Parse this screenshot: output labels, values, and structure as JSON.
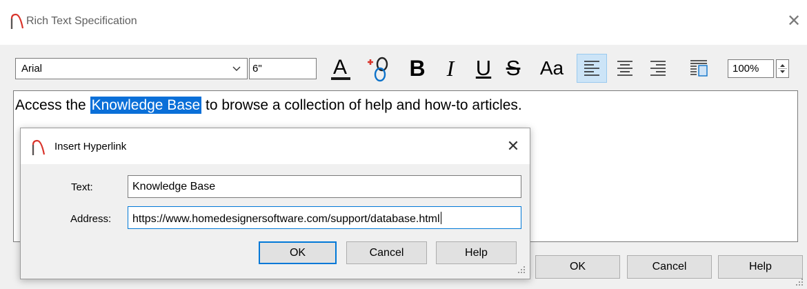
{
  "main_window": {
    "title": "Rich Text Specification",
    "toolbar": {
      "font": "Arial",
      "size": "6\"",
      "zoom": "100%",
      "case_label": "Aa"
    },
    "editor": {
      "text_before": "Access the ",
      "link_text": "Knowledge Base",
      "text_after": " to browse a collection of help and how-to articles."
    },
    "buttons": {
      "ok": "OK",
      "cancel": "Cancel",
      "help": "Help"
    }
  },
  "dialog": {
    "title": "Insert Hyperlink",
    "text_label": "Text:",
    "text_value": "Knowledge Base",
    "address_label": "Address:",
    "address_value": "https://www.homedesignersoftware.com/support/database.html",
    "buttons": {
      "ok": "OK",
      "cancel": "Cancel",
      "help": "Help"
    }
  },
  "colors": {
    "selection": "#0a6fd8",
    "accent": "#0078d7",
    "app_icon": "#d9342b"
  }
}
